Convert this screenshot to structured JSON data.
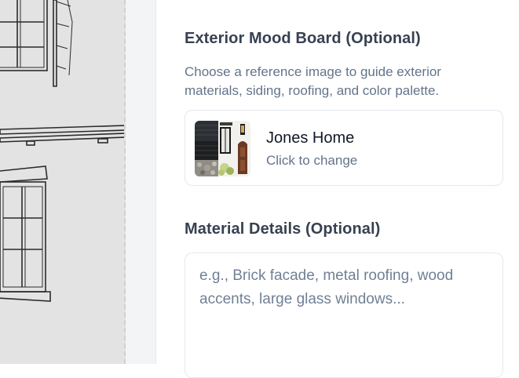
{
  "mood_board": {
    "title": "Exterior Mood Board (Optional)",
    "description": "Choose a reference image to guide exterior materials, siding, roofing, and color palette.",
    "selected": {
      "name": "Jones Home",
      "action_hint": "Click to change"
    }
  },
  "material_details": {
    "title": "Material Details (Optional)",
    "placeholder": "e.g., Brick facade, metal roofing, wood accents, large glass windows...",
    "value": ""
  }
}
